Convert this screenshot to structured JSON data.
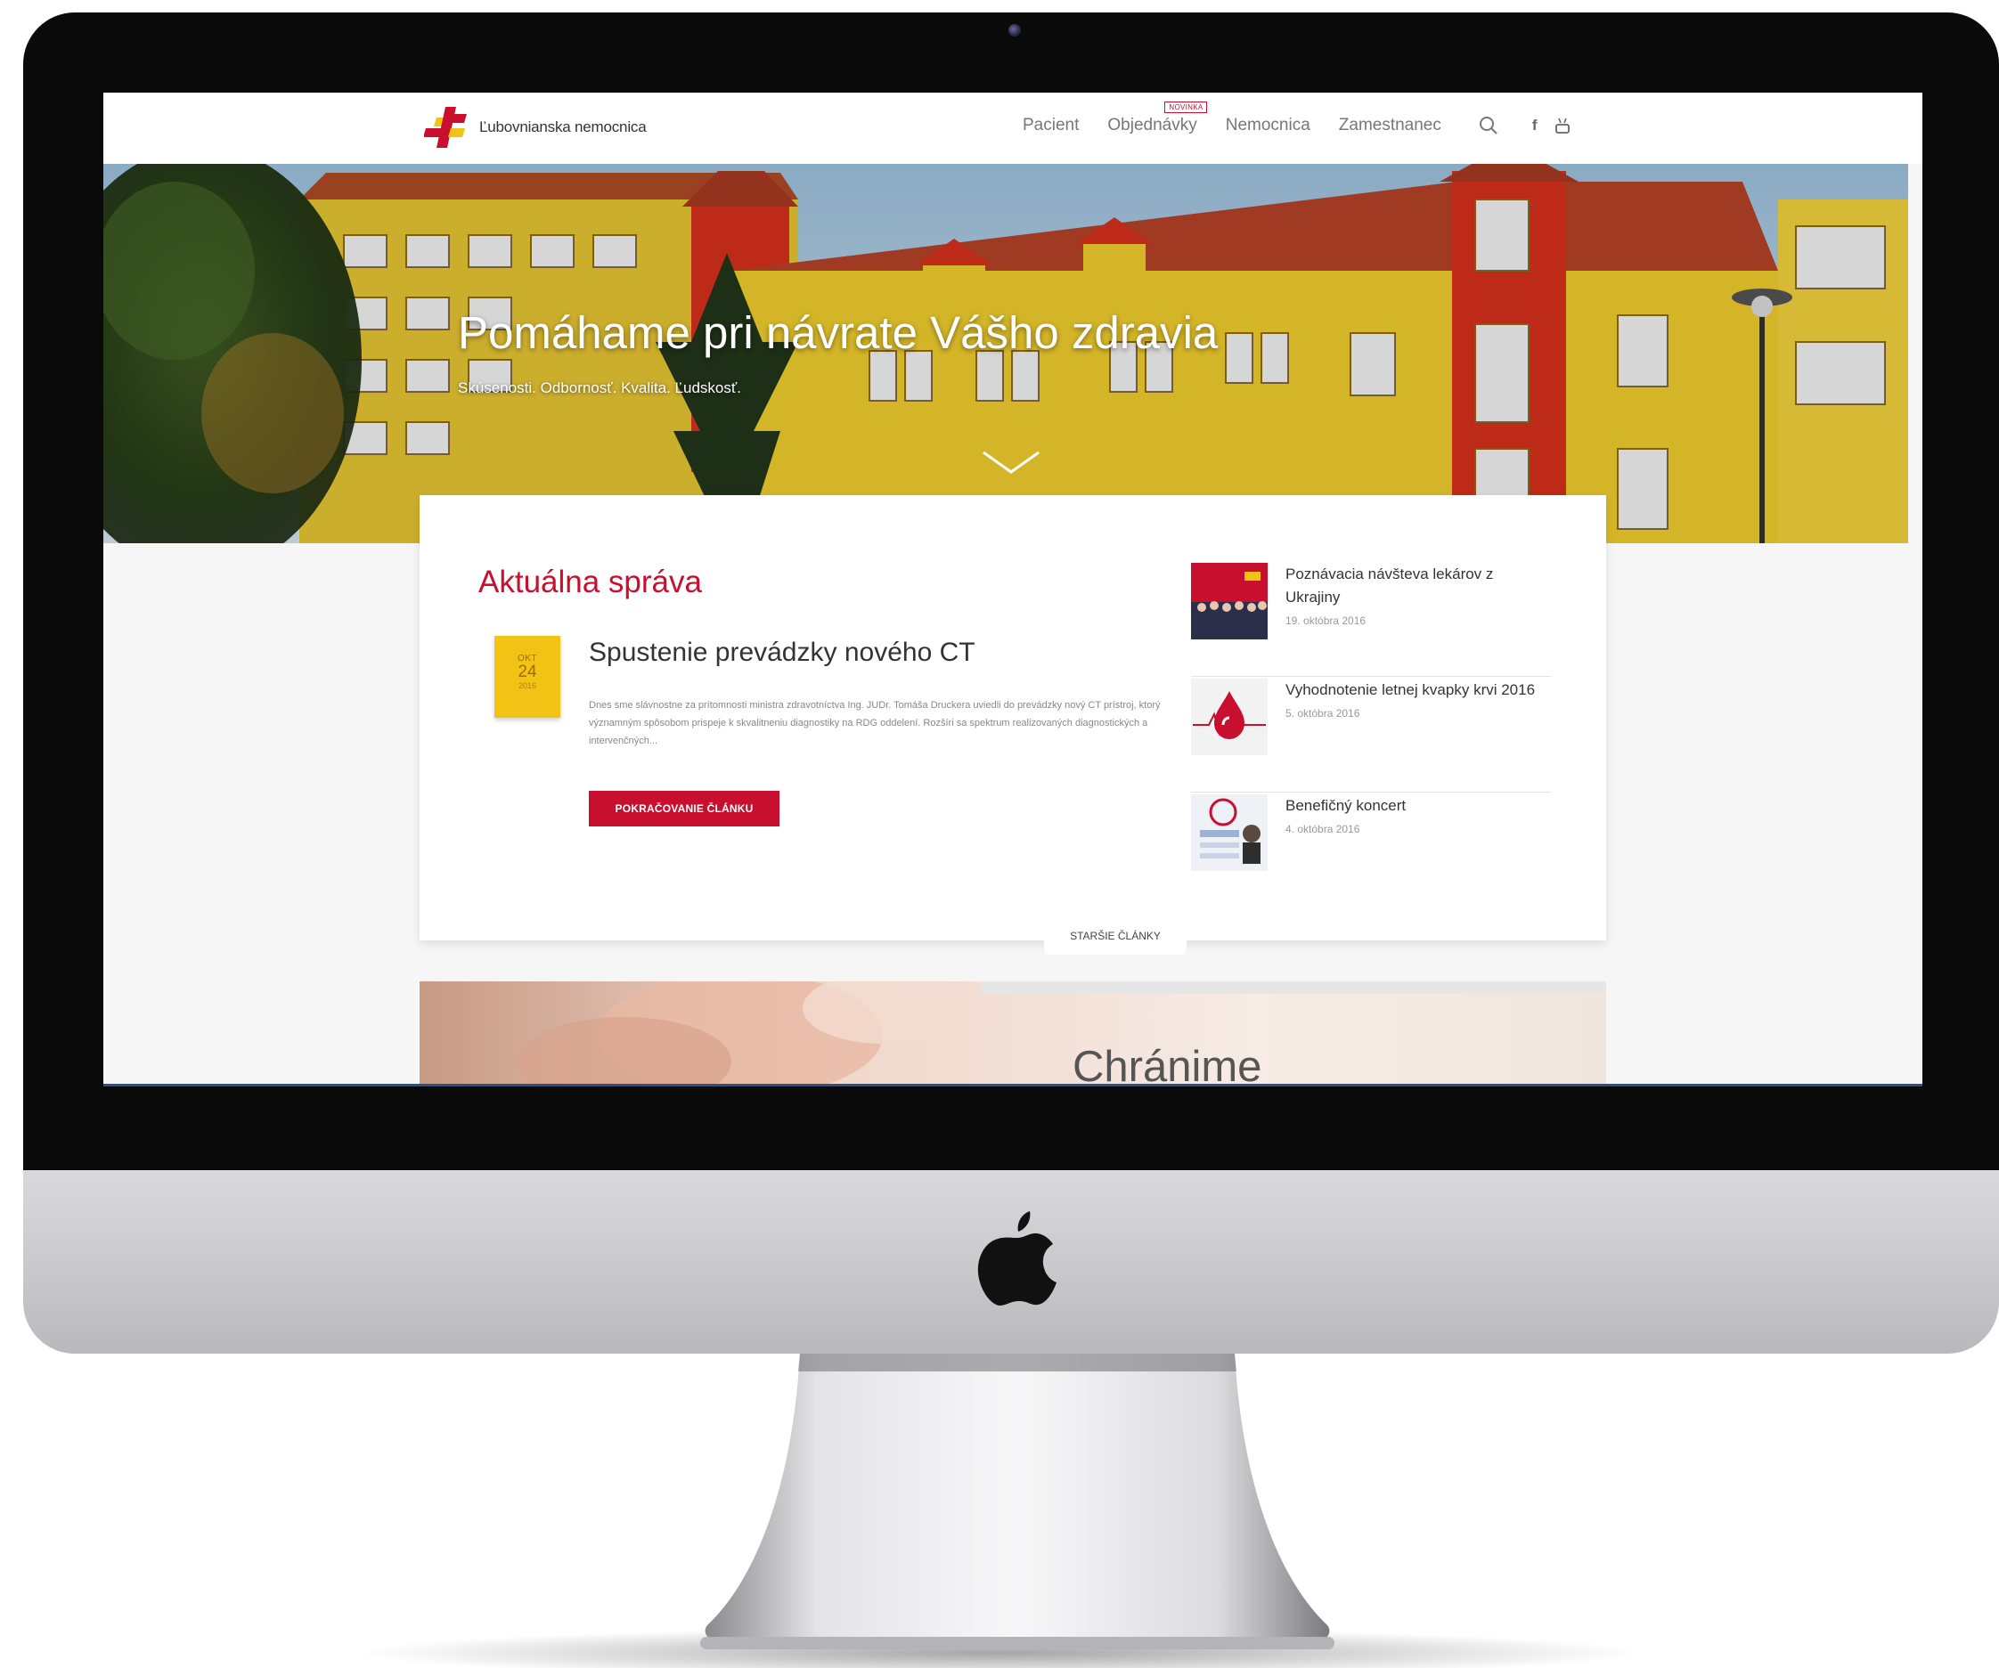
{
  "site": {
    "logo_text": "Ľubovnianska nemocnica"
  },
  "nav": {
    "items": [
      "Pacient",
      "Objednávky",
      "Nemocnica",
      "Zamestnanec"
    ],
    "badge": "NOVINKA",
    "social": [
      "f",
      "yt"
    ]
  },
  "hero": {
    "headline": "Pomáhame pri návrate Vášho zdravia",
    "subtitle": "Skúsenosti. Odbornosť. Kvalita. Ľudskosť."
  },
  "news": {
    "heading": "Aktuálna správa",
    "featured": {
      "date_month": "OKT",
      "date_day": "24",
      "date_year": "2016",
      "title": "Spustenie prevádzky nového CT",
      "excerpt": "Dnes sme slávnostne za prítomnosti ministra zdravotníctva Ing. JUDr. Tomáša Druckera uviedli do prevádzky nový CT prístroj, ktorý významným spôsobom prispeje k skvalitneniu diagnostiky na RDG oddelení. Rozšíri sa spektrum realizovaných diagnostických a intervenčných...",
      "button": "POKRAČOVANIE ČLÁNKU"
    },
    "list": [
      {
        "title": "Poznávacia návšteva lekárov z Ukrajiny",
        "date": "19. októbra 2016"
      },
      {
        "title": "Vyhodnotenie letnej kvapky krvi 2016",
        "date": "5. októbra 2016"
      },
      {
        "title": "Benefičný koncert",
        "date": "4. októbra 2016"
      }
    ],
    "older_button": "STARŠIE ČLÁNKY"
  },
  "banner": {
    "word": "Chránime"
  },
  "colors": {
    "accent": "#c8102e",
    "date_badge": "#f2c214",
    "building_yellow": "#f2cf2e",
    "building_red": "#d8321c"
  },
  "icons": [
    "search-icon",
    "facebook-icon",
    "youtube-icon",
    "chevron-down-icon",
    "apple-logo-icon"
  ]
}
